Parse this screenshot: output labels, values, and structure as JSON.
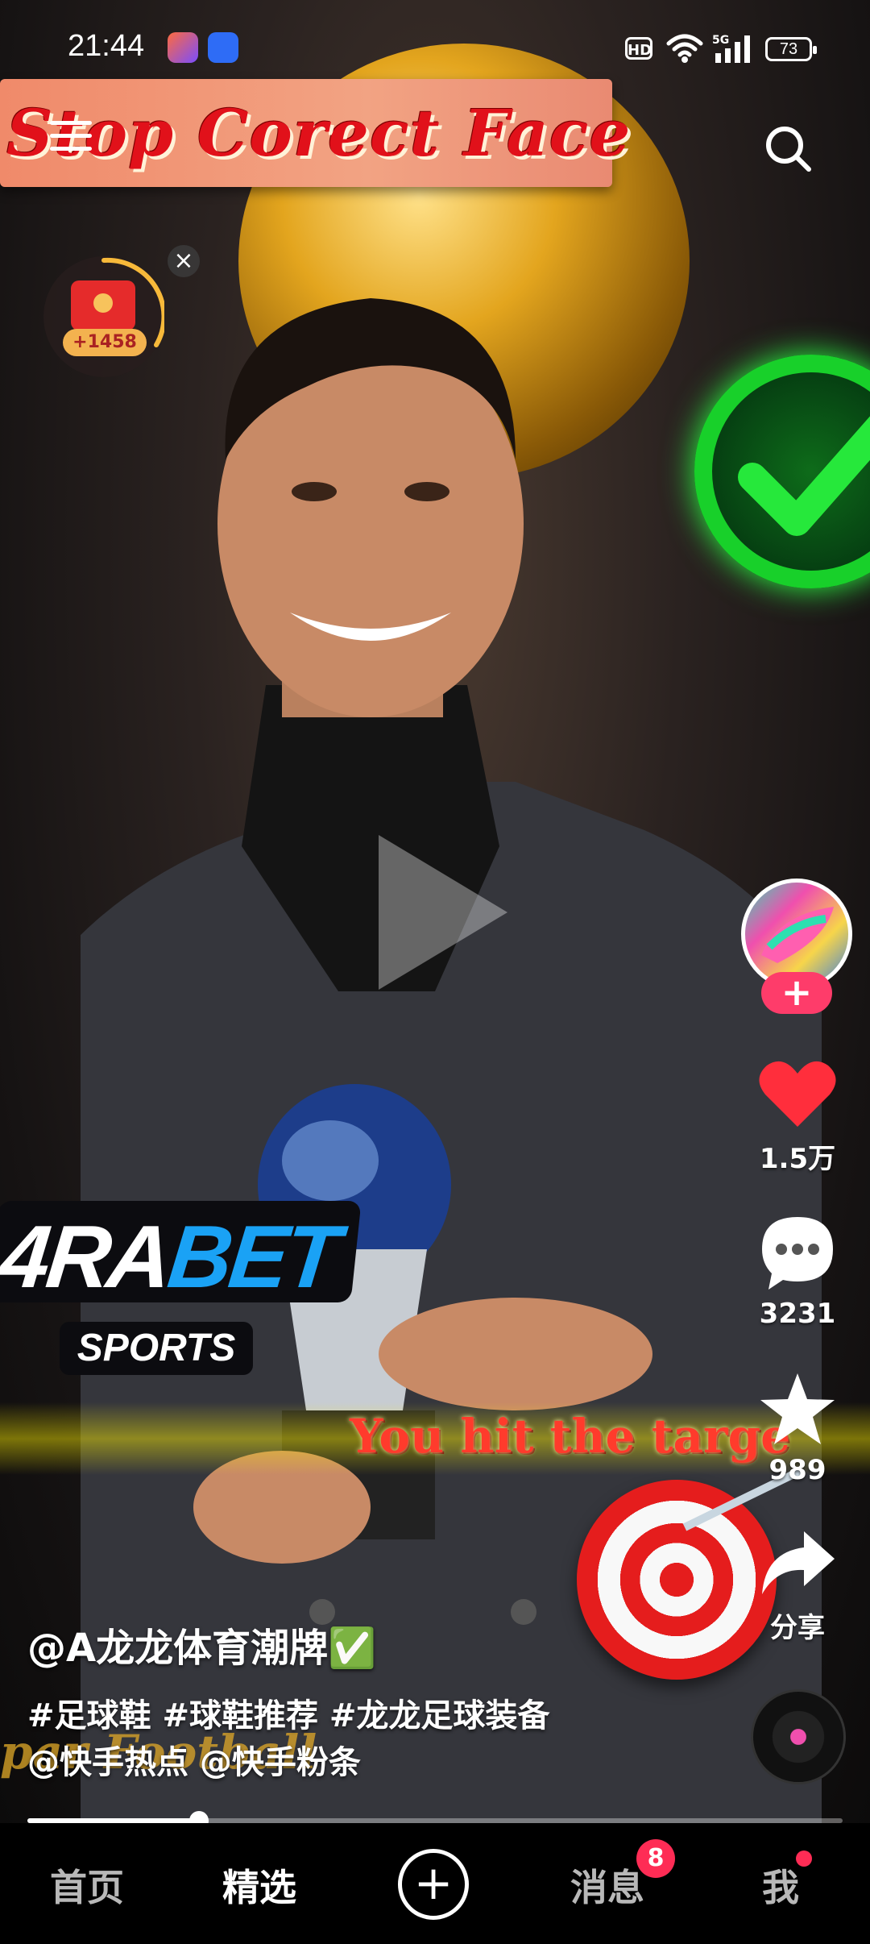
{
  "status_bar": {
    "time": "21:44",
    "hd_label": "HD",
    "network_label": "5G",
    "battery": "73"
  },
  "video": {
    "overlay_title": "Stop Corect Face",
    "overlay_bottom_text": "You hit the targe",
    "watermark_text": "par Football",
    "sponsor_logo_a": "4RA",
    "sponsor_logo_b": "BET",
    "sponsor_sub": "SPORTS",
    "progress_fraction": 0.21
  },
  "reward_widget": {
    "amount": "+1458",
    "close": "×"
  },
  "actions": {
    "follow": "+",
    "likes": "1.5万",
    "comments": "3231",
    "favorites": "989",
    "share": "分享"
  },
  "caption": {
    "author": "@A龙龙体育潮牌✅",
    "tags": "#足球鞋 #球鞋推荐 #龙龙足球装备",
    "mentions": "@快手热点 @快手粉条"
  },
  "nav": {
    "home": "首页",
    "featured": "精选",
    "create": "+",
    "messages": "消息",
    "messages_badge": "8",
    "me": "我"
  },
  "colors": {
    "accent": "#fe2c55",
    "like_red": "#ff2e3c",
    "banner_text": "#e1111a"
  }
}
